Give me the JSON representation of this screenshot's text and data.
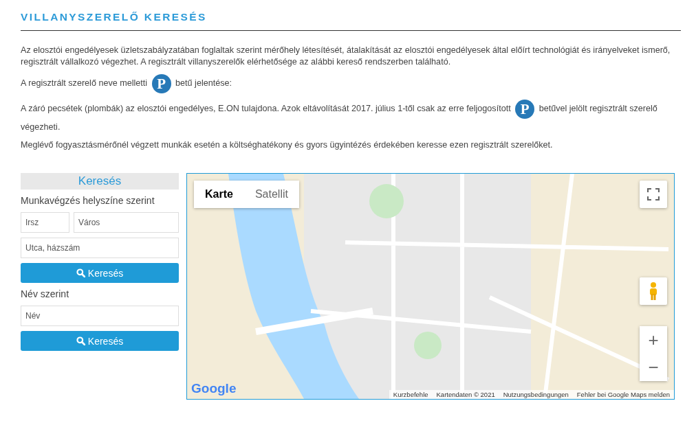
{
  "heading": "VILLANYSZERELŐ KERESÉS",
  "intro": [
    {
      "before": "Az elosztói engedélyesek üzletszabályzatában foglaltak szerint mérőhely létesítését, átalakítását az elosztói engedélyesek által előírt technológiát és irányelveket ismerő, regisztrált vállalkozó végezhet. A regisztrált villanyszerelők elérhetősége az alábbi kereső rendszerben található."
    },
    {
      "before": "A regisztrált szerelő neve melletti",
      "badge": "P",
      "after": "betű jelentése:"
    },
    {
      "before": "A záró pecsétek (plombák) az elosztói engedélyes, E.ON tulajdona. Azok eltávolítását 2017. július 1-től csak az erre feljogosított",
      "badge": "P",
      "after": "betűvel jelölt regisztrált szerelő",
      "tail": "végezheti."
    },
    {
      "before": "Meglévő fogyasztásmérőnél végzett munkák esetén a költséghatékony és gyors ügyintézés érdekében keresse ezen regisztrált szerelőket."
    }
  ],
  "search": {
    "title": "Keresés",
    "location_label": "Munkavégzés helyszíne szerint",
    "zip": {
      "placeholder": "Irsz"
    },
    "city": {
      "placeholder": "Város"
    },
    "street": {
      "placeholder": "Utca, házszám"
    },
    "location_button": "Keresés",
    "name_label": "Név szerint",
    "name": {
      "placeholder": "Név"
    },
    "name_button": "Keresés"
  },
  "map": {
    "tabs": [
      {
        "label": "Karte",
        "selected": true
      },
      {
        "label": "Satellit",
        "selected": false
      }
    ],
    "zoom_in": "+",
    "zoom_out": "−",
    "logo": "Google",
    "footer": [
      "Kurzbefehle",
      "Kartendaten © 2021",
      "Nutzungsbedingungen",
      "Fehler bei Google Maps melden"
    ]
  }
}
